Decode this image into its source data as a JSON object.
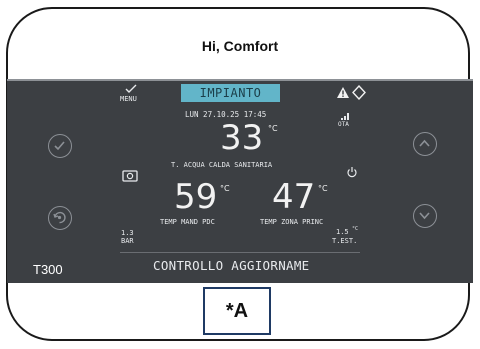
{
  "header": {
    "greeting": "Hi, Comfort"
  },
  "display": {
    "menu_label": "MENU",
    "mode_title": "IMPIANTO",
    "datetime": "LUN 27.10.25 17:45",
    "main_temp": "33",
    "main_temp_unit": "°C",
    "main_temp_caption": "T. ACQUA CALDA SANITARIA",
    "supply_temp": "59",
    "supply_temp_unit": "°C",
    "supply_temp_caption": "TEMP MAND PDC",
    "zone_temp": "47",
    "zone_temp_unit": "°C",
    "zone_temp_caption": "TEMP ZONA PRINC",
    "pressure_value": "1.3",
    "pressure_unit": "BAR",
    "outdoor_value": "1.5",
    "outdoor_unit": "°C",
    "outdoor_caption": "T.EST.",
    "ota_label": "OTA",
    "status_message": "CONTROLLO AGGIORNAME"
  },
  "device": {
    "model": "T300"
  },
  "annotation": {
    "label": "*A"
  },
  "icons": [
    "check-icon",
    "eco-mode-icon",
    "chevron-up-icon",
    "chevron-down-icon",
    "warning-icon",
    "diamond-nav-icon",
    "signal-icon",
    "power-icon",
    "camera-icon"
  ]
}
